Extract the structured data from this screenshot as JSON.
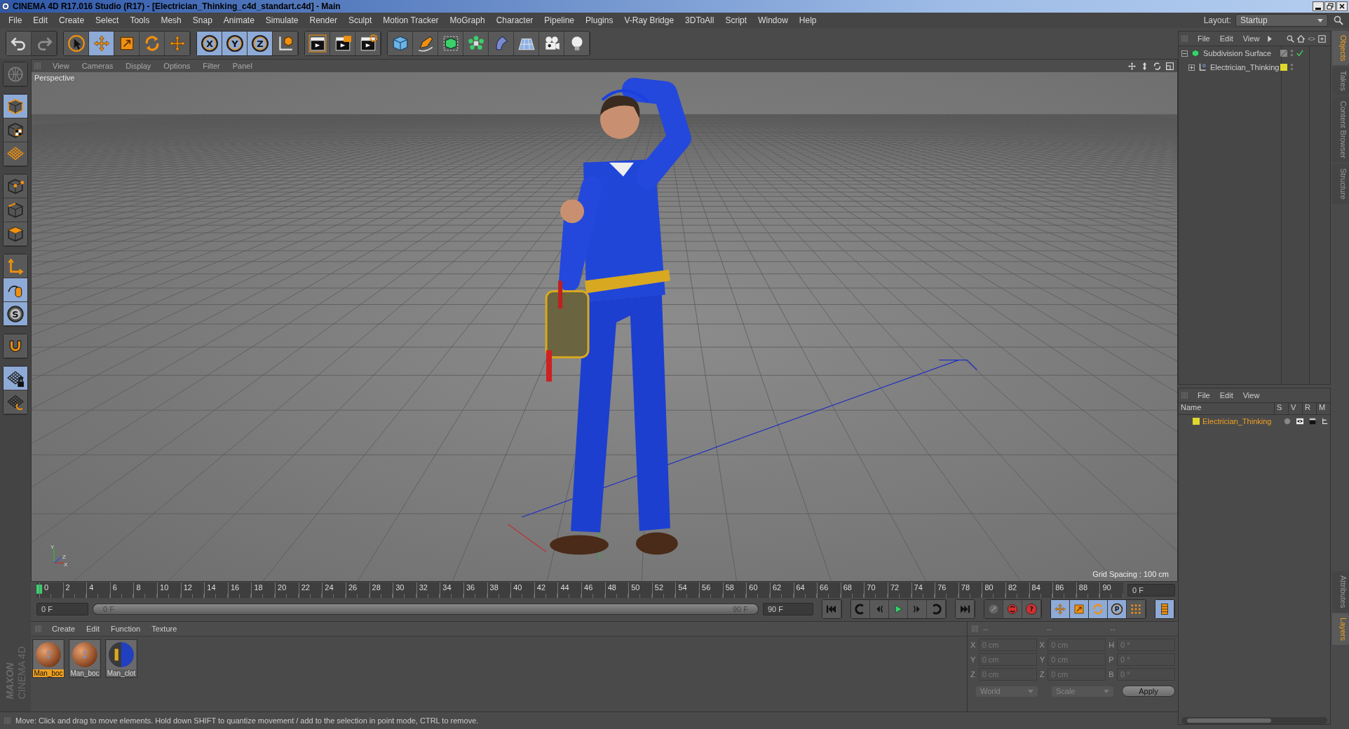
{
  "window": {
    "title": "CINEMA 4D R17.016 Studio (R17) - [Electrician_Thinking_c4d_standart.c4d] - Main"
  },
  "menu": [
    "File",
    "Edit",
    "Create",
    "Select",
    "Tools",
    "Mesh",
    "Snap",
    "Animate",
    "Simulate",
    "Render",
    "Sculpt",
    "Motion Tracker",
    "MoGraph",
    "Character",
    "Pipeline",
    "Plugins",
    "V-Ray Bridge",
    "3DToAll",
    "Script",
    "Window",
    "Help"
  ],
  "layout": {
    "label": "Layout:",
    "value": "Startup"
  },
  "toolbar_groups": [
    [
      {
        "kind": "undo",
        "selected": false,
        "disabled": false
      },
      {
        "kind": "redo",
        "selected": false,
        "disabled": true
      }
    ],
    [
      {
        "kind": "select",
        "selected": false,
        "disabled": false
      },
      {
        "kind": "move",
        "selected": true,
        "disabled": false
      },
      {
        "kind": "scale",
        "selected": false,
        "disabled": false
      },
      {
        "kind": "rotate",
        "selected": false,
        "disabled": false
      },
      {
        "kind": "move",
        "selected": false,
        "disabled": false
      }
    ],
    [
      {
        "kind": "axislock",
        "label": "X",
        "selected": true,
        "disabled": false
      },
      {
        "kind": "axislock",
        "label": "Y",
        "selected": true,
        "disabled": false
      },
      {
        "kind": "axislock",
        "label": "Z",
        "selected": true,
        "disabled": false
      },
      {
        "kind": "coord",
        "selected": false,
        "disabled": false
      }
    ],
    [
      {
        "kind": "renderview",
        "selected": false,
        "disabled": false
      },
      {
        "kind": "renderpicture",
        "selected": false,
        "disabled": false
      },
      {
        "kind": "rendersettings",
        "selected": false,
        "disabled": false
      }
    ],
    [
      {
        "kind": "cube",
        "selected": false,
        "disabled": false
      },
      {
        "kind": "pen",
        "selected": false,
        "disabled": false
      },
      {
        "kind": "subdiv",
        "selected": false,
        "disabled": false
      },
      {
        "kind": "cloner",
        "selected": false,
        "disabled": false
      },
      {
        "kind": "bend",
        "selected": false,
        "disabled": false
      },
      {
        "kind": "floor",
        "selected": false,
        "disabled": false
      },
      {
        "kind": "camera",
        "selected": false,
        "disabled": false
      },
      {
        "kind": "light",
        "selected": false,
        "disabled": false
      }
    ]
  ],
  "left_tool_groups": [
    [
      {
        "kind": "globe",
        "selected": false,
        "disabled": true
      }
    ],
    [
      {
        "kind": "model",
        "selected": true,
        "disabled": false
      },
      {
        "kind": "texture",
        "selected": false,
        "disabled": false
      },
      {
        "kind": "workplane",
        "selected": false,
        "disabled": false
      }
    ],
    [
      {
        "kind": "points",
        "selected": false,
        "disabled": false
      },
      {
        "kind": "edges",
        "selected": false,
        "disabled": false
      },
      {
        "kind": "polygons",
        "selected": false,
        "disabled": false
      }
    ],
    [
      {
        "kind": "axis",
        "selected": false,
        "disabled": false
      },
      {
        "kind": "mouse",
        "selected": true,
        "disabled": false
      },
      {
        "kind": "snap",
        "label": "S",
        "selected": true,
        "disabled": false
      }
    ],
    [
      {
        "kind": "magnet",
        "selected": false,
        "disabled": false
      }
    ],
    [
      {
        "kind": "gridlock",
        "selected": true,
        "disabled": false
      },
      {
        "kind": "gridrotate",
        "selected": false,
        "disabled": false
      }
    ]
  ],
  "viewport": {
    "menu": [
      "View",
      "Cameras",
      "Display",
      "Options",
      "Filter",
      "Panel"
    ],
    "camera": "Perspective",
    "grid_spacing": "Grid Spacing : 100 cm",
    "axis_labels": [
      "Y",
      "Z",
      "X"
    ]
  },
  "timeline": {
    "ticks": [
      "0",
      "2",
      "4",
      "6",
      "8",
      "10",
      "12",
      "14",
      "16",
      "18",
      "20",
      "22",
      "24",
      "26",
      "28",
      "30",
      "32",
      "34",
      "36",
      "38",
      "40",
      "42",
      "44",
      "46",
      "48",
      "50",
      "52",
      "54",
      "56",
      "58",
      "60",
      "62",
      "64",
      "66",
      "68",
      "70",
      "72",
      "74",
      "76",
      "78",
      "80",
      "82",
      "84",
      "86",
      "88",
      "90"
    ],
    "current_frame": "0 F",
    "start_field": "0 F",
    "range_start": "0 F",
    "range_end": "90 F",
    "end_field": "90 F",
    "range": {
      "level": 1
    },
    "control_groups": [
      [
        {
          "kind": "first",
          "selected": false,
          "disabled": false
        }
      ],
      [
        {
          "kind": "prevkey",
          "selected": false,
          "disabled": false
        },
        {
          "kind": "prevframe",
          "selected": false,
          "disabled": false
        },
        {
          "kind": "play",
          "selected": false,
          "disabled": false
        },
        {
          "kind": "nextframe",
          "selected": false,
          "disabled": false
        },
        {
          "kind": "nextkey",
          "selected": false,
          "disabled": false
        }
      ],
      [
        {
          "kind": "last",
          "selected": false,
          "disabled": false
        }
      ],
      [
        {
          "kind": "record",
          "selected": false,
          "disabled": true
        },
        {
          "kind": "autokey",
          "selected": false,
          "disabled": false
        },
        {
          "kind": "keyhelp",
          "label": "?",
          "selected": false,
          "disabled": false
        }
      ],
      [
        {
          "kind": "move",
          "selected": true,
          "disabled": false
        },
        {
          "kind": "scale",
          "selected": true,
          "disabled": false
        },
        {
          "kind": "rotate",
          "selected": true,
          "disabled": false
        },
        {
          "kind": "pkey",
          "label": "P",
          "selected": true,
          "disabled": false
        },
        {
          "kind": "dots",
          "selected": false,
          "disabled": false
        }
      ],
      [
        {
          "kind": "film",
          "selected": true,
          "disabled": false
        }
      ]
    ]
  },
  "materials": {
    "menu": [
      "Create",
      "Edit",
      "Function",
      "Texture"
    ],
    "items": [
      {
        "name": "Man_boc",
        "kind": "skin",
        "selected": true
      },
      {
        "name": "Man_boc",
        "kind": "skin",
        "selected": false
      },
      {
        "name": "Man_clot",
        "kind": "cloth",
        "selected": false
      }
    ]
  },
  "coordinates": {
    "headers": [
      "--",
      "--",
      "--"
    ],
    "disabled": true,
    "rows": [
      [
        {
          "axis": "X",
          "value": "0 cm"
        },
        {
          "axis": "X",
          "value": "0 cm"
        },
        {
          "axis": "H",
          "value": "0 °"
        }
      ],
      [
        {
          "axis": "Y",
          "value": "0 cm"
        },
        {
          "axis": "Y",
          "value": "0 cm"
        },
        {
          "axis": "P",
          "value": "0 °"
        }
      ],
      [
        {
          "axis": "Z",
          "value": "0 cm"
        },
        {
          "axis": "Z",
          "value": "0 cm"
        },
        {
          "axis": "B",
          "value": "0 °"
        }
      ]
    ],
    "dropdowns": [
      "World",
      "Scale"
    ],
    "apply": "Apply"
  },
  "logo": [
    "MAXON",
    "CINEMA 4D"
  ],
  "status_bar": "Move: Click and drag to move elements. Hold down SHIFT to quantize movement / add to the selection in point mode, CTRL to remove.",
  "objects_panel": {
    "menu": [
      "File",
      "Edit",
      "View"
    ],
    "tree": [
      {
        "name": "Subdivision Surface",
        "kind": "subdiv",
        "expanded": true,
        "enabled": true,
        "children": [
          {
            "name": "Electrician_Thinking",
            "kind": "null",
            "expanded": false,
            "enabled": false,
            "color": "#e0d82c"
          }
        ]
      }
    ]
  },
  "layers_panel": {
    "menu": [
      "File",
      "Edit",
      "View"
    ],
    "columns": [
      "Name",
      "S",
      "V",
      "R",
      "M"
    ],
    "rows": [
      {
        "name": "Electrician_Thinking",
        "color": "#e0d82c"
      }
    ]
  },
  "side_tabs": [
    {
      "label": "Objects",
      "selected": true
    },
    {
      "label": "Takes",
      "selected": false
    },
    {
      "label": "Content Browser",
      "selected": false
    },
    {
      "label": "Structure",
      "selected": false
    }
  ],
  "side_tabs_lower": [
    {
      "label": "Attributes",
      "selected": false
    },
    {
      "label": "Layers",
      "selected": true
    }
  ]
}
